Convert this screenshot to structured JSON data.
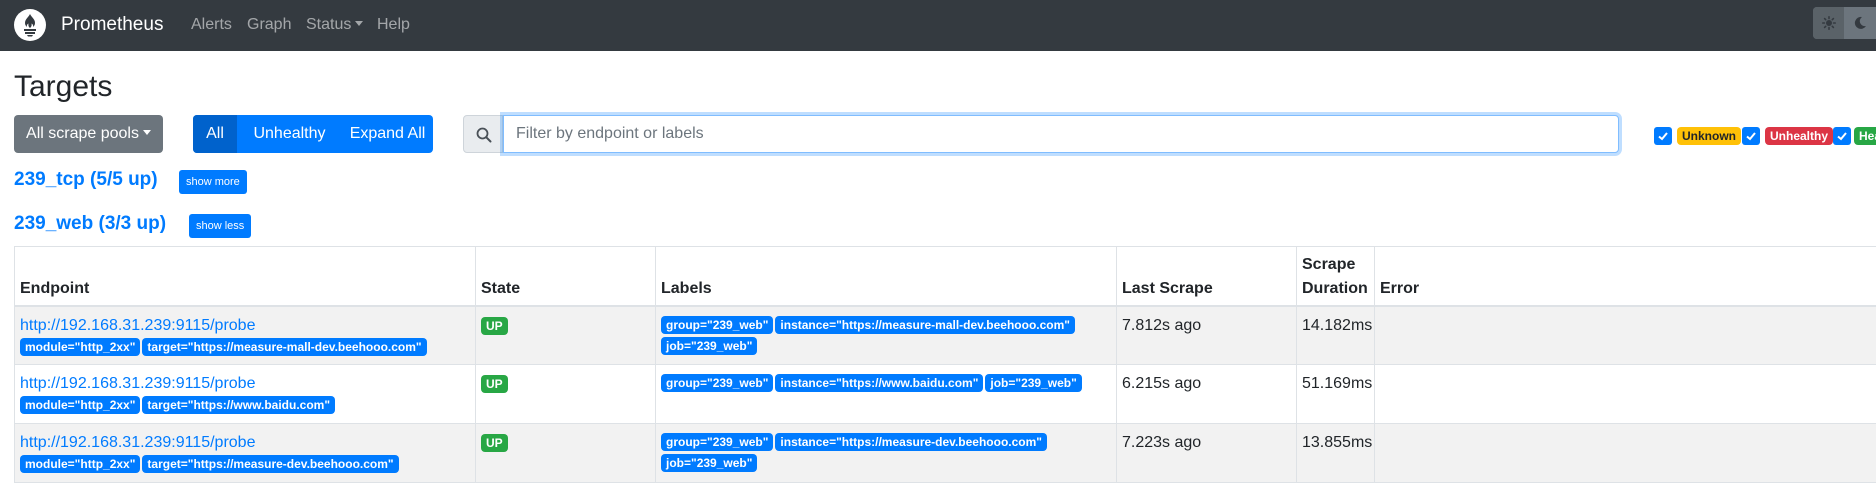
{
  "navbar": {
    "brand": "Prometheus",
    "links": {
      "alerts": "Alerts",
      "graph": "Graph",
      "status": "Status",
      "help": "Help"
    }
  },
  "page": {
    "title": "Targets"
  },
  "toolbar": {
    "scrape_pools_label": "All scrape pools",
    "filter_all": "All",
    "filter_unhealthy": "Unhealthy",
    "expand_all": "Expand All",
    "search_placeholder": "Filter by endpoint or labels",
    "search_value": "",
    "health_filters": [
      {
        "label": "Unknown",
        "checked": true
      },
      {
        "label": "Unhealthy",
        "checked": true
      },
      {
        "label": "Hea",
        "checked": true
      }
    ]
  },
  "pools": [
    {
      "title": "239_tcp (5/5 up)",
      "toggle": "show more"
    },
    {
      "title": "239_web (3/3 up)",
      "toggle": "show less"
    }
  ],
  "table": {
    "headers": {
      "endpoint": "Endpoint",
      "state": "State",
      "labels": "Labels",
      "last_scrape": "Last Scrape",
      "scrape_duration_1": "Scrape",
      "scrape_duration_2": "Duration",
      "error": "Error"
    },
    "rows": [
      {
        "endpoint": "http://192.168.31.239:9115/probe",
        "params": [
          "module=\"http_2xx\"",
          "target=\"https://measure-mall-dev.beehooo.com\""
        ],
        "state": "UP",
        "labels": [
          "group=\"239_web\"",
          "instance=\"https://measure-mall-dev.beehooo.com\"",
          "job=\"239_web\""
        ],
        "last_scrape": "7.812s ago",
        "duration": "14.182ms",
        "error": ""
      },
      {
        "endpoint": "http://192.168.31.239:9115/probe",
        "params": [
          "module=\"http_2xx\"",
          "target=\"https://www.baidu.com\""
        ],
        "state": "UP",
        "labels": [
          "group=\"239_web\"",
          "instance=\"https://www.baidu.com\"",
          "job=\"239_web\""
        ],
        "last_scrape": "6.215s ago",
        "duration": "51.169ms",
        "error": ""
      },
      {
        "endpoint": "http://192.168.31.239:9115/probe",
        "params": [
          "module=\"http_2xx\"",
          "target=\"https://measure-dev.beehooo.com\""
        ],
        "state": "UP",
        "labels": [
          "group=\"239_web\"",
          "instance=\"https://measure-dev.beehooo.com\"",
          "job=\"239_web\""
        ],
        "last_scrape": "7.223s ago",
        "duration": "13.855ms",
        "error": ""
      }
    ]
  },
  "colors": {
    "navbar": "#343a40",
    "primary": "#007bff",
    "secondary": "#6c757d",
    "success": "#28a745",
    "warning": "#ffc107",
    "danger": "#dc3545"
  },
  "icons": {
    "logo": "prometheus-logo",
    "theme_light": "sun-icon",
    "theme_dark": "moon-icon",
    "search": "search-icon",
    "checkbox": "check-icon"
  }
}
